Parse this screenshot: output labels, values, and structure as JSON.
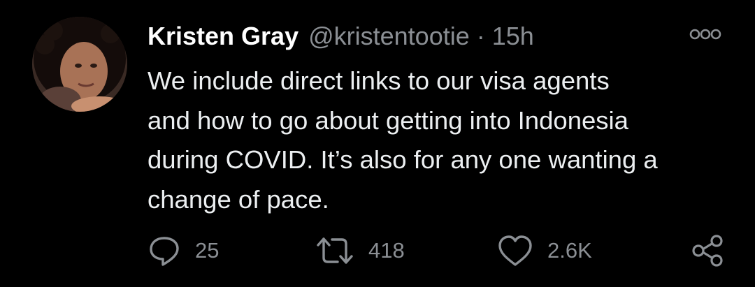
{
  "tweet": {
    "author_name": "Kristen Gray",
    "author_handle": "@kristentootie",
    "separator": "·",
    "time_ago": "15h",
    "text_lines": [
      "We include direct links to our visa agents",
      "and how to go about getting into Indonesia",
      "during COVID. It’s also for any one wanting a",
      "change of pace."
    ]
  },
  "actions": {
    "replies": "25",
    "retweets": "418",
    "likes": "2.6K"
  },
  "icons": {
    "more": "more-options-icon",
    "reply": "reply-icon",
    "retweet": "retweet-icon",
    "like": "heart-icon",
    "share": "share-icon"
  },
  "colors": {
    "background": "#000000",
    "name": "#ffffff",
    "text": "#eceff1",
    "secondary": "#8b8f94"
  }
}
